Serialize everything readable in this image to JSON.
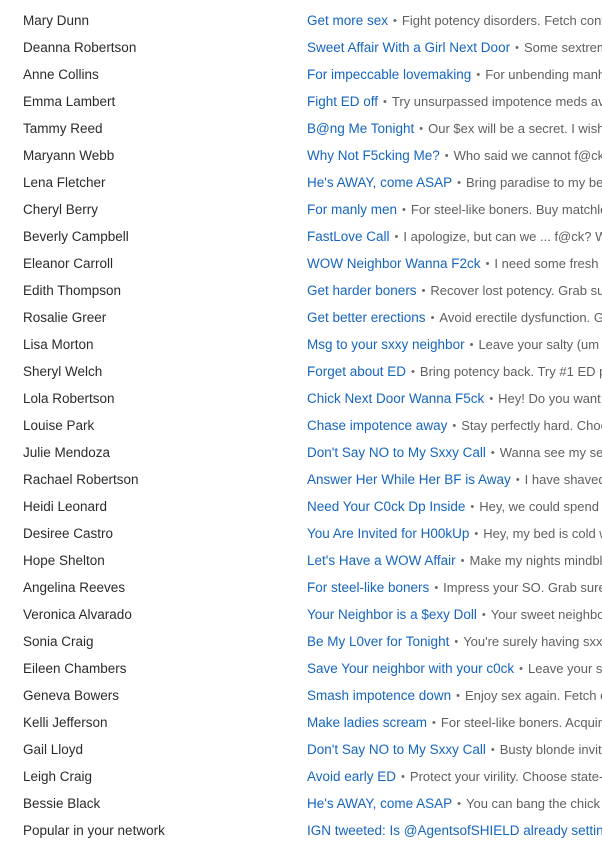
{
  "separator": "•",
  "messages": [
    {
      "sender": "Mary Dunn",
      "subject": "Get more sex",
      "preview": "Fight potency disorders. Fetch contem"
    },
    {
      "sender": "Deanna Robertson",
      "subject": "Sweet Affair With a Girl Next Door",
      "preview": "Some sextreme"
    },
    {
      "sender": "Anne Collins",
      "subject": "For impeccable lovemaking",
      "preview": "For unbending manho"
    },
    {
      "sender": "Emma Lambert",
      "subject": "Fight ED off",
      "preview": "Try unsurpassed impotence meds availa"
    },
    {
      "sender": "Tammy Reed",
      "subject": "B@ng Me Tonight",
      "preview": "Our $ex will be a secret.  I wish to"
    },
    {
      "sender": "Maryann Webb",
      "subject": "Why Not F5cking Me?",
      "preview": "Who said we cannot f@ck go"
    },
    {
      "sender": "Lena Fletcher",
      "subject": "He's AWAY, come ASAP",
      "preview": "Bring paradise to my bedro"
    },
    {
      "sender": "Cheryl Berry",
      "subject": "For manly men",
      "preview": "For steel-like boners.  Buy matchless"
    },
    {
      "sender": "Beverly Campbell",
      "subject": "FastLove Call",
      "preview": "I apologize, but can we ... f@ck?  Watc"
    },
    {
      "sender": "Eleanor Carroll",
      "subject": "WOW Neighbor Wanna F2ck",
      "preview": "I need some fresh fee"
    },
    {
      "sender": "Edith Thompson",
      "subject": "Get harder boners",
      "preview": "Recover lost potency.  Grab suref"
    },
    {
      "sender": "Rosalie Greer",
      "subject": "Get better erections",
      "preview": "Avoid erectile dysfunction. Grab"
    },
    {
      "sender": "Lisa Morton",
      "subject": "Msg to your sxxy neighbor",
      "preview": "Leave your salty (um or"
    },
    {
      "sender": "Sheryl Welch",
      "subject": "Forget about ED",
      "preview": "Bring potency back.  Try #1 ED pills"
    },
    {
      "sender": "Lola Robertson",
      "subject": "Chick Next Door Wanna F5ck",
      "preview": "Hey! Do you want to"
    },
    {
      "sender": "Louise Park",
      "subject": "Chase impotence away",
      "preview": "Stay perfectly hard. Choose"
    },
    {
      "sender": "Julie Mendoza",
      "subject": "Don't Say NO to My Sxxy Call",
      "preview": "Wanna see my sensu"
    },
    {
      "sender": "Rachael Robertson",
      "subject": "Answer Her While Her BF is Away",
      "preview": "I have shaved my"
    },
    {
      "sender": "Heidi Leonard",
      "subject": "Need Your C0ck Dp Inside",
      "preview": "Hey, we could spend this"
    },
    {
      "sender": "Desiree Castro",
      "subject": "You Are Invited for H00kUp",
      "preview": "Hey, my bed is cold wit"
    },
    {
      "sender": "Hope Shelton",
      "subject": "Let's Have a WOW Affair",
      "preview": "Make my nights mindblow"
    },
    {
      "sender": "Angelina Reeves",
      "subject": "For steel-like boners",
      "preview": "Impress your SO. Grab surefire"
    },
    {
      "sender": "Veronica Alvarado",
      "subject": "Your Neighbor is a $exy Doll",
      "preview": "Your sweet neighbor w"
    },
    {
      "sender": "Sonia Craig",
      "subject": "Be My L0ver for Tonight",
      "preview": "You're surely having sxx ton"
    },
    {
      "sender": "Eileen Chambers",
      "subject": "Save Your neighbor with your c0ck",
      "preview": "Leave your salty"
    },
    {
      "sender": "Geneva Bowers",
      "subject": "Smash impotence down",
      "preview": "Enjoy sex again.  Fetch exc"
    },
    {
      "sender": "Kelli Jefferson",
      "subject": "Make ladies scream",
      "preview": "For steel-like boners. Acquire av"
    },
    {
      "sender": "Gail Lloyd",
      "subject": "Don't Say NO to My Sxxy Call",
      "preview": "Busty blonde invites y"
    },
    {
      "sender": "Leigh Craig",
      "subject": "Avoid early ED",
      "preview": "Protect your virility. Choose state-of-"
    },
    {
      "sender": "Bessie Black",
      "subject": "He's AWAY, come ASAP",
      "preview": "You can bang the chick you"
    },
    {
      "sender": "Popular in your network",
      "subject": "IGN tweeted: Is @AgentsofSHIELD already setting u",
      "preview": ""
    }
  ]
}
